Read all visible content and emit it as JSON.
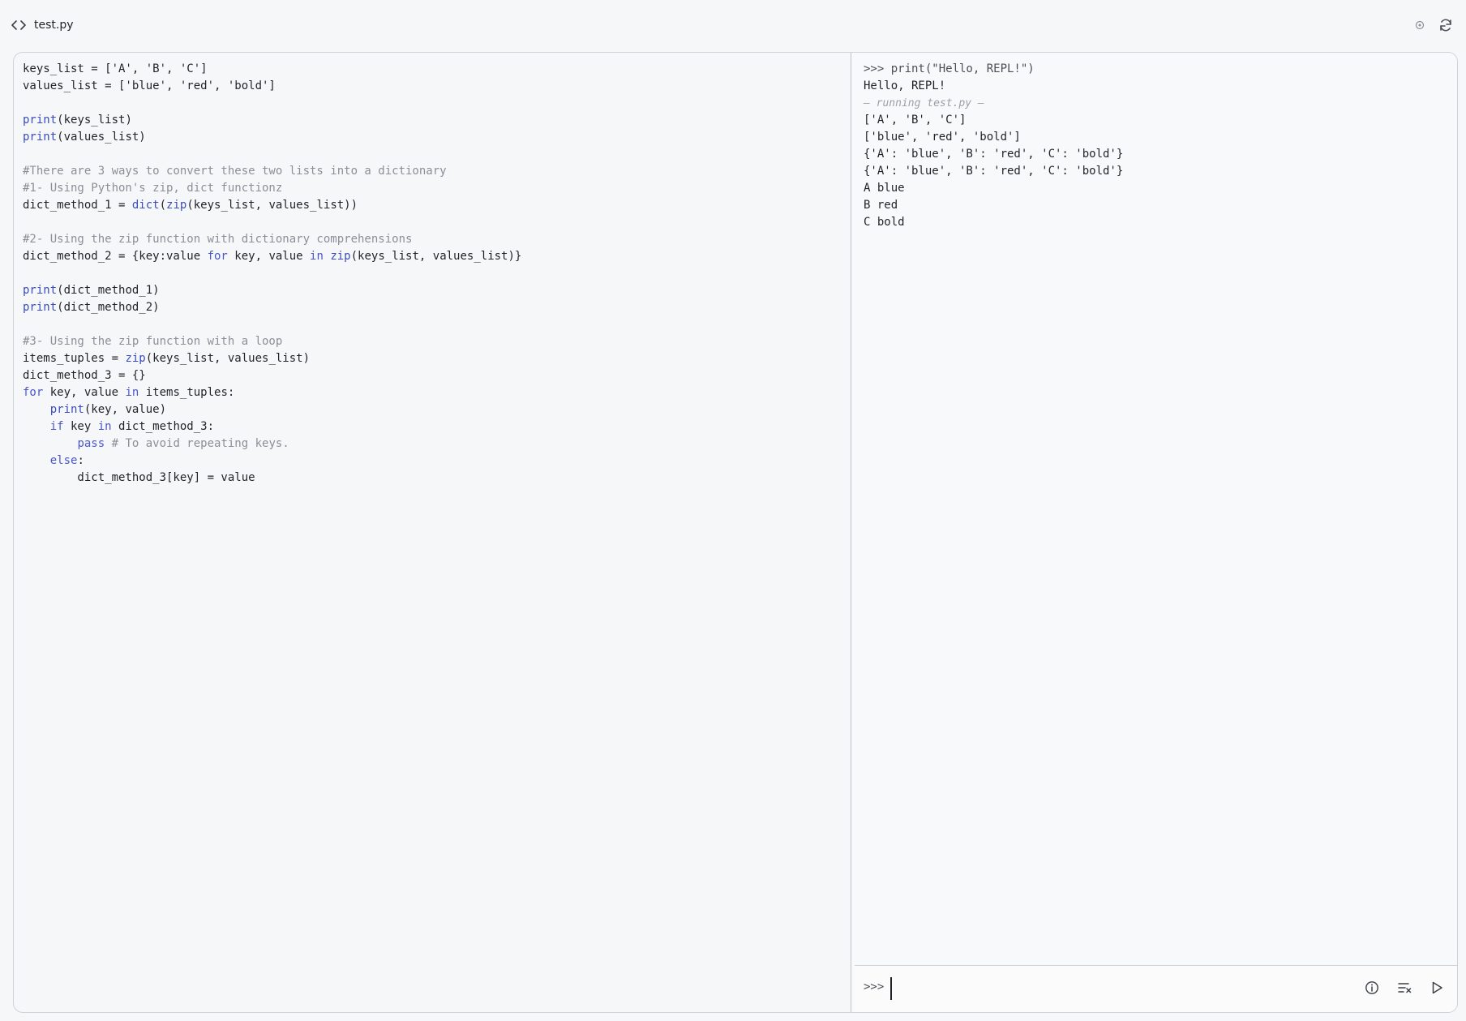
{
  "file_tab": {
    "name": "test.py",
    "icon": "code-icon"
  },
  "top_actions": {
    "status_icon": "circle-dot-icon",
    "refresh_icon": "refresh-icon"
  },
  "editor": {
    "lines": [
      [
        {
          "t": "tx",
          "s": "keys_list = ['A', 'B', 'C']"
        }
      ],
      [
        {
          "t": "tx",
          "s": "values_list = ['blue', 'red', 'bold']"
        }
      ],
      [],
      [
        {
          "t": "fn",
          "s": "print"
        },
        {
          "t": "tx",
          "s": "(keys_list)"
        }
      ],
      [
        {
          "t": "fn",
          "s": "print"
        },
        {
          "t": "tx",
          "s": "(values_list)"
        }
      ],
      [],
      [
        {
          "t": "cm",
          "s": "#There are 3 ways to convert these two lists into a dictionary"
        }
      ],
      [
        {
          "t": "cm",
          "s": "#1- Using Python's zip, dict functionz"
        }
      ],
      [
        {
          "t": "tx",
          "s": "dict_method_1 = "
        },
        {
          "t": "fn",
          "s": "dict"
        },
        {
          "t": "tx",
          "s": "("
        },
        {
          "t": "fn",
          "s": "zip"
        },
        {
          "t": "tx",
          "s": "(keys_list, values_list))"
        }
      ],
      [],
      [
        {
          "t": "cm",
          "s": "#2- Using the zip function with dictionary comprehensions"
        }
      ],
      [
        {
          "t": "tx",
          "s": "dict_method_2 = {key:value "
        },
        {
          "t": "kw",
          "s": "for"
        },
        {
          "t": "tx",
          "s": " key, value "
        },
        {
          "t": "kw",
          "s": "in"
        },
        {
          "t": "tx",
          "s": " "
        },
        {
          "t": "fn",
          "s": "zip"
        },
        {
          "t": "tx",
          "s": "(keys_list, values_list)}"
        }
      ],
      [],
      [
        {
          "t": "fn",
          "s": "print"
        },
        {
          "t": "tx",
          "s": "(dict_method_1)"
        }
      ],
      [
        {
          "t": "fn",
          "s": "print"
        },
        {
          "t": "tx",
          "s": "(dict_method_2)"
        }
      ],
      [],
      [
        {
          "t": "cm",
          "s": "#3- Using the zip function with a loop"
        }
      ],
      [
        {
          "t": "tx",
          "s": "items_tuples = "
        },
        {
          "t": "fn",
          "s": "zip"
        },
        {
          "t": "tx",
          "s": "(keys_list, values_list)"
        }
      ],
      [
        {
          "t": "tx",
          "s": "dict_method_3 = {}"
        }
      ],
      [
        {
          "t": "kw",
          "s": "for"
        },
        {
          "t": "tx",
          "s": " key, value "
        },
        {
          "t": "kw",
          "s": "in"
        },
        {
          "t": "tx",
          "s": " items_tuples:"
        }
      ],
      [
        {
          "t": "tx",
          "s": "    "
        },
        {
          "t": "fn",
          "s": "print"
        },
        {
          "t": "tx",
          "s": "(key, value)"
        }
      ],
      [
        {
          "t": "tx",
          "s": "    "
        },
        {
          "t": "kw",
          "s": "if"
        },
        {
          "t": "tx",
          "s": " key "
        },
        {
          "t": "kw",
          "s": "in"
        },
        {
          "t": "tx",
          "s": " dict_method_3:"
        }
      ],
      [
        {
          "t": "tx",
          "s": "        "
        },
        {
          "t": "kw",
          "s": "pass"
        },
        {
          "t": "tx",
          "s": " "
        },
        {
          "t": "cm",
          "s": "# To avoid repeating keys."
        }
      ],
      [
        {
          "t": "tx",
          "s": "    "
        },
        {
          "t": "kw",
          "s": "else"
        },
        {
          "t": "tx",
          "s": ":"
        }
      ],
      [
        {
          "t": "tx",
          "s": "        dict_method_3[key] = value"
        }
      ]
    ]
  },
  "repl": {
    "output": [
      {
        "kind": "echo",
        "text": ">>> print(\"Hello, REPL!\")"
      },
      {
        "kind": "out",
        "text": "Hello, REPL!"
      },
      {
        "kind": "note",
        "text": "— running test.py —"
      },
      {
        "kind": "out",
        "text": "['A', 'B', 'C']"
      },
      {
        "kind": "out",
        "text": "['blue', 'red', 'bold']"
      },
      {
        "kind": "out",
        "text": "{'A': 'blue', 'B': 'red', 'C': 'bold'}"
      },
      {
        "kind": "out",
        "text": "{'A': 'blue', 'B': 'red', 'C': 'bold'}"
      },
      {
        "kind": "out",
        "text": "A blue"
      },
      {
        "kind": "out",
        "text": "B red"
      },
      {
        "kind": "out",
        "text": "C bold"
      }
    ],
    "prompt": ">>>",
    "input_value": "",
    "actions": {
      "info_icon": "info-icon",
      "clear_icon": "clear-output-icon",
      "run_icon": "run-icon"
    }
  },
  "colors": {
    "keyword": "#4b56c8",
    "comment": "#8a8f98",
    "builtin": "#3a4cbf",
    "text": "#1f2328"
  }
}
